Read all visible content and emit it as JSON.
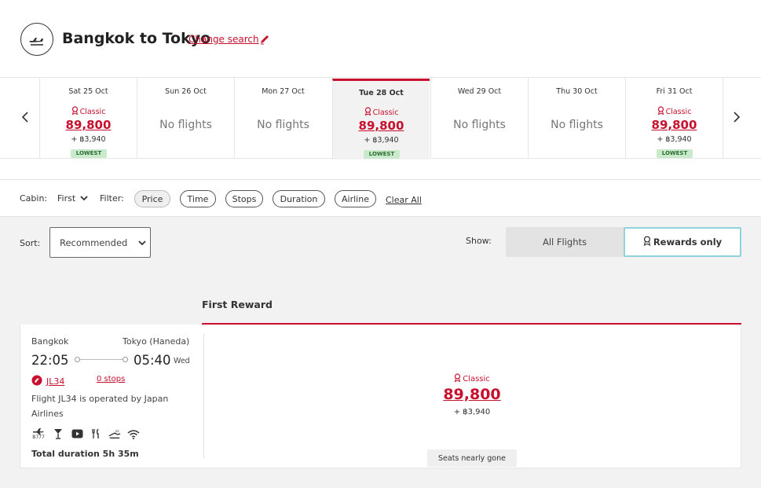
{
  "header": {
    "title": "Bangkok to Tokyo",
    "change_search": "Change search"
  },
  "dates": [
    {
      "date": "Sat 25 Oct",
      "cabin": "Classic",
      "price": "89,800",
      "tax": "+ ฿3,940",
      "badge": "LOWEST"
    },
    {
      "date": "Sun 26 Oct",
      "no_flights": "No flights"
    },
    {
      "date": "Mon 27 Oct",
      "no_flights": "No flights"
    },
    {
      "date": "Tue 28 Oct",
      "cabin": "Classic",
      "price": "89,800",
      "tax": "+ ฿3,940",
      "badge": "LOWEST",
      "selected": true
    },
    {
      "date": "Wed 29 Oct",
      "no_flights": "No flights"
    },
    {
      "date": "Thu 30 Oct",
      "no_flights": "No flights"
    },
    {
      "date": "Fri 31 Oct",
      "cabin": "Classic",
      "price": "89,800",
      "tax": "+ ฿3,940",
      "badge": "LOWEST"
    }
  ],
  "filters": {
    "cabin_label": "Cabin:",
    "cabin_value": "First",
    "filter_label": "Filter:",
    "pills": [
      "Price",
      "Time",
      "Stops",
      "Duration",
      "Airline"
    ],
    "clear_all": "Clear All"
  },
  "sort": {
    "label": "Sort:",
    "value": "Recommended"
  },
  "show": {
    "label": "Show:",
    "all_flights": "All Flights",
    "rewards_only": "Rewards only"
  },
  "section": {
    "title": "First Reward"
  },
  "flight": {
    "origin": "Bangkok",
    "destination": "Tokyo (Haneda)",
    "depart_time": "22:05",
    "arrive_time": "05:40",
    "arrive_day": "Wed",
    "flight_no": "JL34",
    "stops": "0 stops",
    "operated_by": "Flight JL34 is operated by Japan Airlines",
    "aircraft": "B777",
    "total_duration": "Total duration 5h 35m",
    "fare": {
      "cabin": "Classic",
      "price": "89,800",
      "tax": "+ ฿3,940",
      "seats": "Seats nearly gone"
    }
  },
  "colors": {
    "accent": "#c8102e",
    "lowest_badge": "#c9ebcc",
    "rewards_border": "#8fd3dd"
  }
}
